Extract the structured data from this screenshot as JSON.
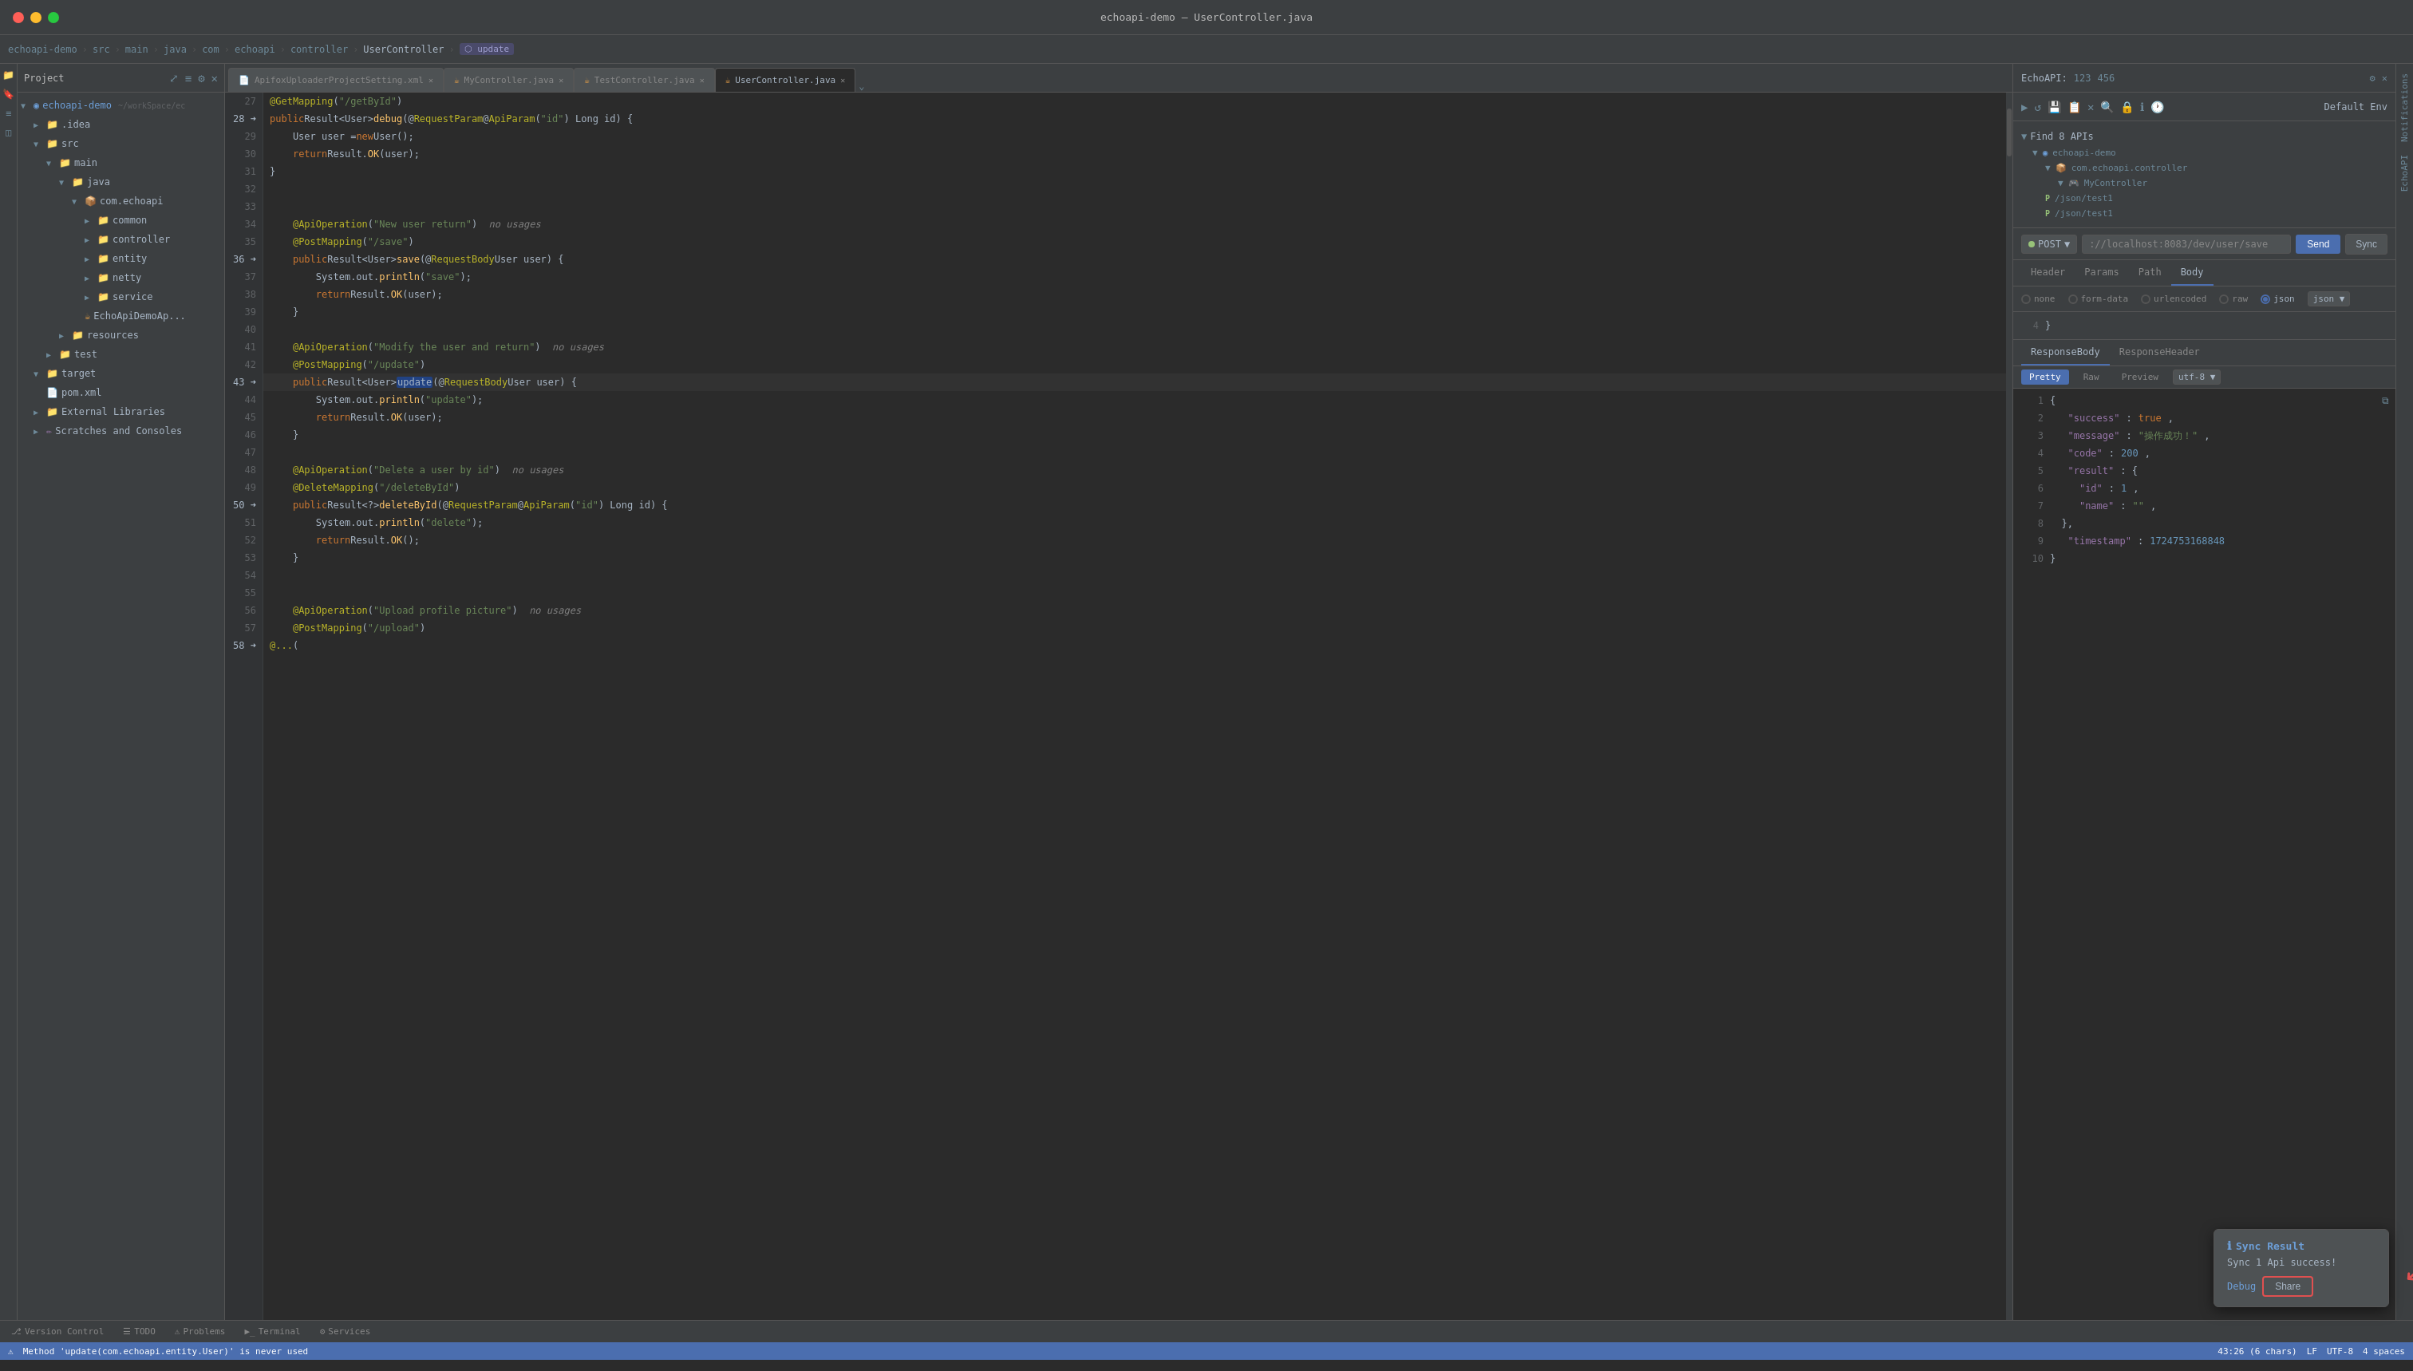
{
  "titlebar": {
    "title": "echoapi-demo – UserController.java"
  },
  "breadcrumb": {
    "items": [
      "echoapi-demo",
      "src",
      "main",
      "java",
      "com",
      "echoapi",
      "controller",
      "UserController",
      "update"
    ]
  },
  "sidebar": {
    "title": "Project",
    "tree": [
      {
        "label": "echoapi-demo",
        "indent": 0,
        "type": "project",
        "expanded": true
      },
      {
        "label": ".idea",
        "indent": 1,
        "type": "folder"
      },
      {
        "label": "src",
        "indent": 1,
        "type": "folder",
        "expanded": true
      },
      {
        "label": "main",
        "indent": 2,
        "type": "folder",
        "expanded": true
      },
      {
        "label": "java",
        "indent": 3,
        "type": "folder",
        "expanded": true
      },
      {
        "label": "com.echoapi",
        "indent": 4,
        "type": "package",
        "expanded": true
      },
      {
        "label": "common",
        "indent": 5,
        "type": "folder"
      },
      {
        "label": "controller",
        "indent": 5,
        "type": "folder",
        "expanded": true
      },
      {
        "label": "entity",
        "indent": 5,
        "type": "folder"
      },
      {
        "label": "netty",
        "indent": 5,
        "type": "folder"
      },
      {
        "label": "service",
        "indent": 5,
        "type": "folder"
      },
      {
        "label": "EchoApiDemoAp...",
        "indent": 5,
        "type": "java"
      },
      {
        "label": "resources",
        "indent": 3,
        "type": "folder"
      },
      {
        "label": "test",
        "indent": 2,
        "type": "folder"
      },
      {
        "label": "target",
        "indent": 1,
        "type": "folder",
        "expanded": true
      },
      {
        "label": "pom.xml",
        "indent": 2,
        "type": "xml"
      },
      {
        "label": "External Libraries",
        "indent": 1,
        "type": "folder"
      },
      {
        "label": "Scratches and Consoles",
        "indent": 1,
        "type": "folder"
      }
    ]
  },
  "tabs": [
    {
      "label": "ApifoxUploaderProjectSetting.xml",
      "type": "xml",
      "active": false
    },
    {
      "label": "MyController.java",
      "type": "java",
      "active": false
    },
    {
      "label": "TestController.java",
      "type": "java",
      "active": false
    },
    {
      "label": "UserController.java",
      "type": "java",
      "active": true
    }
  ],
  "editor": {
    "lines": [
      {
        "num": 27,
        "content": "    @GetMapping(\"/getById\")",
        "arrow": false
      },
      {
        "num": 28,
        "content": "    public Result<User> debug(@RequestParam @ApiParam(\"id\") Long id) {",
        "arrow": true
      },
      {
        "num": 29,
        "content": "        User user = new User();",
        "arrow": false
      },
      {
        "num": 30,
        "content": "        return Result.OK(user);",
        "arrow": false
      },
      {
        "num": 31,
        "content": "    }",
        "arrow": false
      },
      {
        "num": 32,
        "content": "",
        "arrow": false
      },
      {
        "num": 33,
        "content": "",
        "arrow": false
      },
      {
        "num": 34,
        "content": "    @ApiOperation(\"New user return\")  no usages",
        "arrow": false
      },
      {
        "num": 35,
        "content": "    @PostMapping(\"/save\")",
        "arrow": false
      },
      {
        "num": 36,
        "content": "    public Result<User> save(@RequestBody User user) {",
        "arrow": true
      },
      {
        "num": 37,
        "content": "        System.out.println(\"save\");",
        "arrow": false
      },
      {
        "num": 38,
        "content": "        return Result.OK(user);",
        "arrow": false
      },
      {
        "num": 39,
        "content": "    }",
        "arrow": false
      },
      {
        "num": 40,
        "content": "",
        "arrow": false
      },
      {
        "num": 41,
        "content": "    @ApiOperation(\"Modify the user and return\")  no usages",
        "arrow": false
      },
      {
        "num": 42,
        "content": "    @PostMapping(\"/update\")",
        "arrow": false
      },
      {
        "num": 43,
        "content": "    public Result<User> update(@RequestBody User user) {",
        "arrow": true,
        "current": true
      },
      {
        "num": 44,
        "content": "        System.out.println(\"update\");",
        "arrow": false
      },
      {
        "num": 45,
        "content": "        return Result.OK(user);",
        "arrow": false
      },
      {
        "num": 46,
        "content": "    }",
        "arrow": false
      },
      {
        "num": 47,
        "content": "",
        "arrow": false
      },
      {
        "num": 48,
        "content": "    @ApiOperation(\"Delete a user by id\")  no usages",
        "arrow": false
      },
      {
        "num": 49,
        "content": "    @DeleteMapping(\"/deleteById\")",
        "arrow": false
      },
      {
        "num": 50,
        "content": "    public Result<?> deleteById(@RequestParam @ApiParam(\"id\") Long id) {",
        "arrow": true
      },
      {
        "num": 51,
        "content": "        System.out.println(\"delete\");",
        "arrow": false
      },
      {
        "num": 52,
        "content": "        return Result.OK();",
        "arrow": false
      },
      {
        "num": 53,
        "content": "    }",
        "arrow": false
      },
      {
        "num": 54,
        "content": "",
        "arrow": false
      },
      {
        "num": 55,
        "content": "",
        "arrow": false
      },
      {
        "num": 56,
        "content": "    @ApiOperation(\"Upload profile picture\")  no usages",
        "arrow": false
      },
      {
        "num": 57,
        "content": "    @PostMapping(\"/upload\")",
        "arrow": false
      },
      {
        "num": 58,
        "content": "    @...(",
        "arrow": true
      }
    ]
  },
  "rightPanel": {
    "header": {
      "title": "EchoAPI:",
      "num1": "123",
      "num2": "456"
    },
    "apiTree": {
      "title": "Find 8 APIs",
      "project": "echoapi-demo",
      "package": "com.echoapi.controller",
      "controller": "MyController",
      "endpoints": [
        {
          "method": "P",
          "path": "/json/test1"
        },
        {
          "method": "P",
          "path": "/json/test1"
        }
      ]
    },
    "request": {
      "method": "POST",
      "url": "://localhost:8083/dev/user/save",
      "tabs": [
        "Header",
        "Params",
        "Path",
        "Body"
      ],
      "activeTab": "Body",
      "bodyOptions": [
        "none",
        "form-data",
        "urlencoded",
        "raw",
        "json"
      ],
      "activeBodyOption": "json",
      "bodyContent": [
        {
          "num": 4,
          "text": "  }"
        }
      ]
    },
    "response": {
      "tabs": [
        "ResponseBody",
        "ResponseHeader"
      ],
      "activeTab": "ResponseBody",
      "viewTabs": [
        "Pretty",
        "Raw",
        "Preview"
      ],
      "activeView": "Pretty",
      "encoding": "utf-8",
      "lines": [
        {
          "num": 1,
          "text": "{"
        },
        {
          "num": 2,
          "text": "  \"success\": true,"
        },
        {
          "num": 3,
          "text": "  \"message\": \"操作成功！\","
        },
        {
          "num": 4,
          "text": "  \"code\": 200,"
        },
        {
          "num": 5,
          "text": "  \"result\": {"
        },
        {
          "num": 6,
          "text": "    \"id\": 1,"
        },
        {
          "num": 7,
          "text": "    \"name\": \"\","
        },
        {
          "num": 8,
          "text": "  },"
        },
        {
          "num": 9,
          "text": "  \"timestamp\": 1724753168848"
        },
        {
          "num": 10,
          "text": "}"
        }
      ]
    },
    "syncPopup": {
      "title": "Sync Result",
      "icon": "ℹ",
      "body": "Sync 1 Api success!",
      "debugLabel": "Debug",
      "shareLabel": "Share"
    }
  },
  "bottomBar": {
    "tabs": [
      "Version Control",
      "TODO",
      "Problems",
      "Terminal",
      "Services"
    ]
  },
  "statusBar": {
    "left": "Method 'update(com.echoapi.entity.User)' is never used",
    "right": "43:26  (6 chars)  LF  UTF-8  4 spaces  ✨"
  }
}
